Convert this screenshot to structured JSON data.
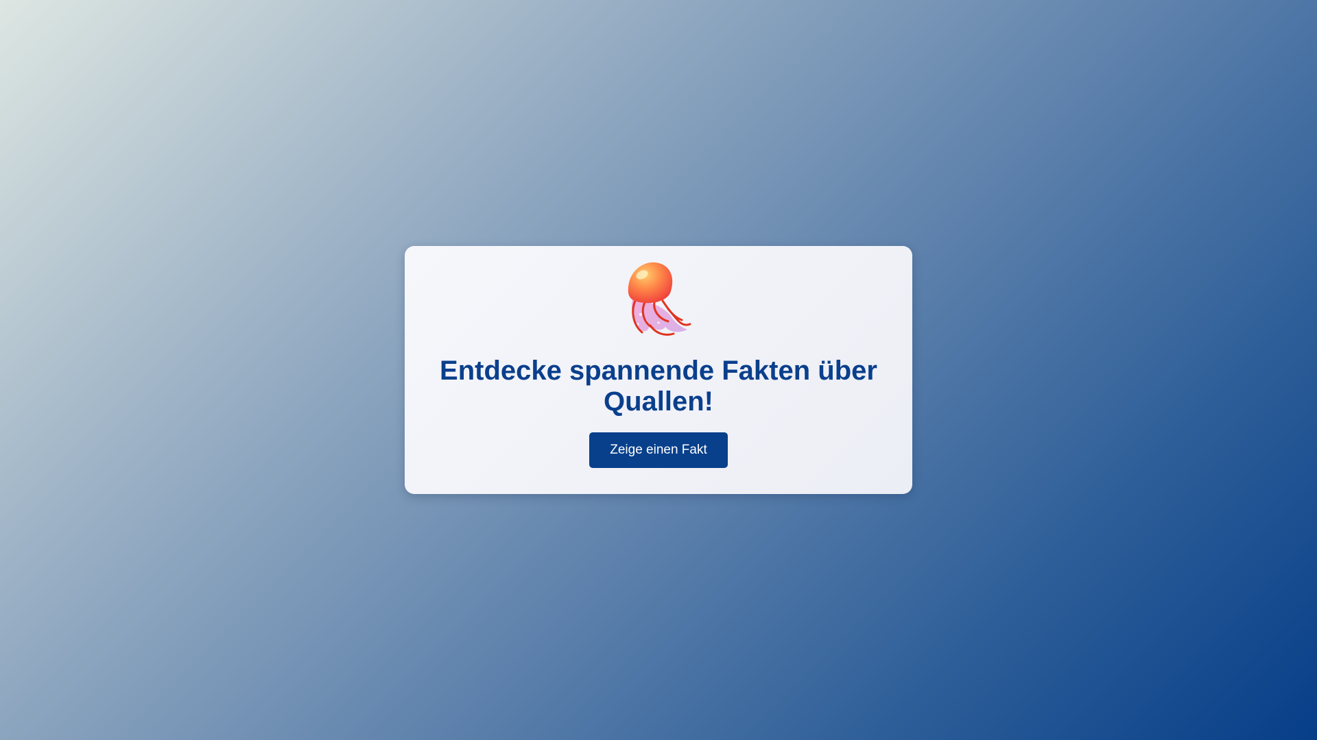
{
  "card": {
    "icon": "jellyfish-icon",
    "title": "Entdecke spannende Fakten über Quallen!",
    "button_label": "Zeige einen Fakt"
  },
  "colors": {
    "title": "#0a3f8c",
    "button_background": "#08408c",
    "button_text": "#ffffff",
    "background_start": "#dde6e2",
    "background_end": "#063e88"
  }
}
